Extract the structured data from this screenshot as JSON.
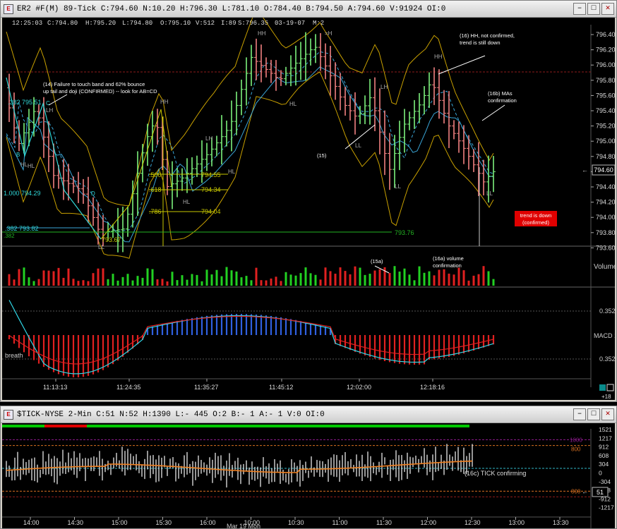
{
  "top_window": {
    "title": "ER2 #F(M) 89-Tick C:794.60 N:10.20 H:796.30 L:781.10 O:784.40 B:794.50 A:794.60 V:91924 OI:0",
    "info_bar": [
      "12:25:03",
      "C:794.80",
      "H:795.20",
      "L:794.80",
      "O:795.10",
      "V:512",
      "I:89",
      "S:796.35",
      "03-19-07",
      "M:2"
    ],
    "price_axis": [
      "796.40",
      "796.20",
      "796.00",
      "795.80",
      "795.60",
      "795.40",
      "795.20",
      "795.00",
      "794.80",
      "794.60",
      "794.40",
      "794.20",
      "794.00",
      "793.80",
      "793.60"
    ],
    "current_price_label": "794.60",
    "time_axis": [
      "11:13:13",
      "11:24:35",
      "11:35:27",
      "11:45:12",
      "12:02:00",
      "12:18:16"
    ],
    "volume_label": "Volume",
    "macd_label": "MACD 1",
    "macd_levels": [
      "0.352",
      "0.352"
    ],
    "breath_label": "breath",
    "corner_label": "+18",
    "trend_box": [
      "trend is down",
      "(confirmed)"
    ],
    "annotations": {
      "a14": [
        "(14) Failure to touch band and 62% bounce",
        "up tail and doji (CONFIRMED) -- look for AB=CD"
      ],
      "a15": "(15)",
      "a15a": "(15a)",
      "a16": [
        "(16) HH, not confirmed,",
        "trend is still down"
      ],
      "a16b": [
        "(16b) MAs",
        "confirmation"
      ],
      "a16a": [
        "(16a) volume",
        "confirmation"
      ]
    },
    "swing_labels": [
      "HH",
      "=H",
      "HH",
      "HH",
      "LH",
      "LH",
      "LH",
      "HL",
      "HL",
      "HL",
      "HL",
      "LL",
      "LL",
      "LL",
      "LL",
      "B",
      "C",
      "D",
      "HL"
    ],
    "fib_labels": {
      "l382a": ".382 795.51",
      "l1000": "1.000 794.29",
      "l382b": ".382 793.82",
      "l382c": ".382",
      "p793_67": "793.67",
      "p793_76": "793.76",
      "r500": ".500",
      "r618": ".618",
      "r786": ".786",
      "v794_55": "794.55",
      "v794_34": "794.34",
      "v794_04": "794.04"
    }
  },
  "bottom_window": {
    "title": "$TICK-NYSE 2-Min C:51 N:52 H:1390 L:- 445 O:2 B:- 1 A:- 1 V:0 OI:0",
    "y_axis": [
      "1521",
      "1217",
      "912",
      "608",
      "304",
      "0",
      "-304",
      "-608",
      "-912",
      "-1217"
    ],
    "level_labels": [
      "1000",
      "800",
      "800"
    ],
    "current_label": "51",
    "time_axis": [
      "14:00",
      "14:30",
      "15:00",
      "15:30",
      "16:00",
      "10:00",
      "10:30",
      "11:00",
      "11:30",
      "12:00",
      "12:30",
      "13:00",
      "13:30"
    ],
    "date_label": "Mar 19 Mon",
    "annotation": "(16c) TICK confirming"
  }
}
